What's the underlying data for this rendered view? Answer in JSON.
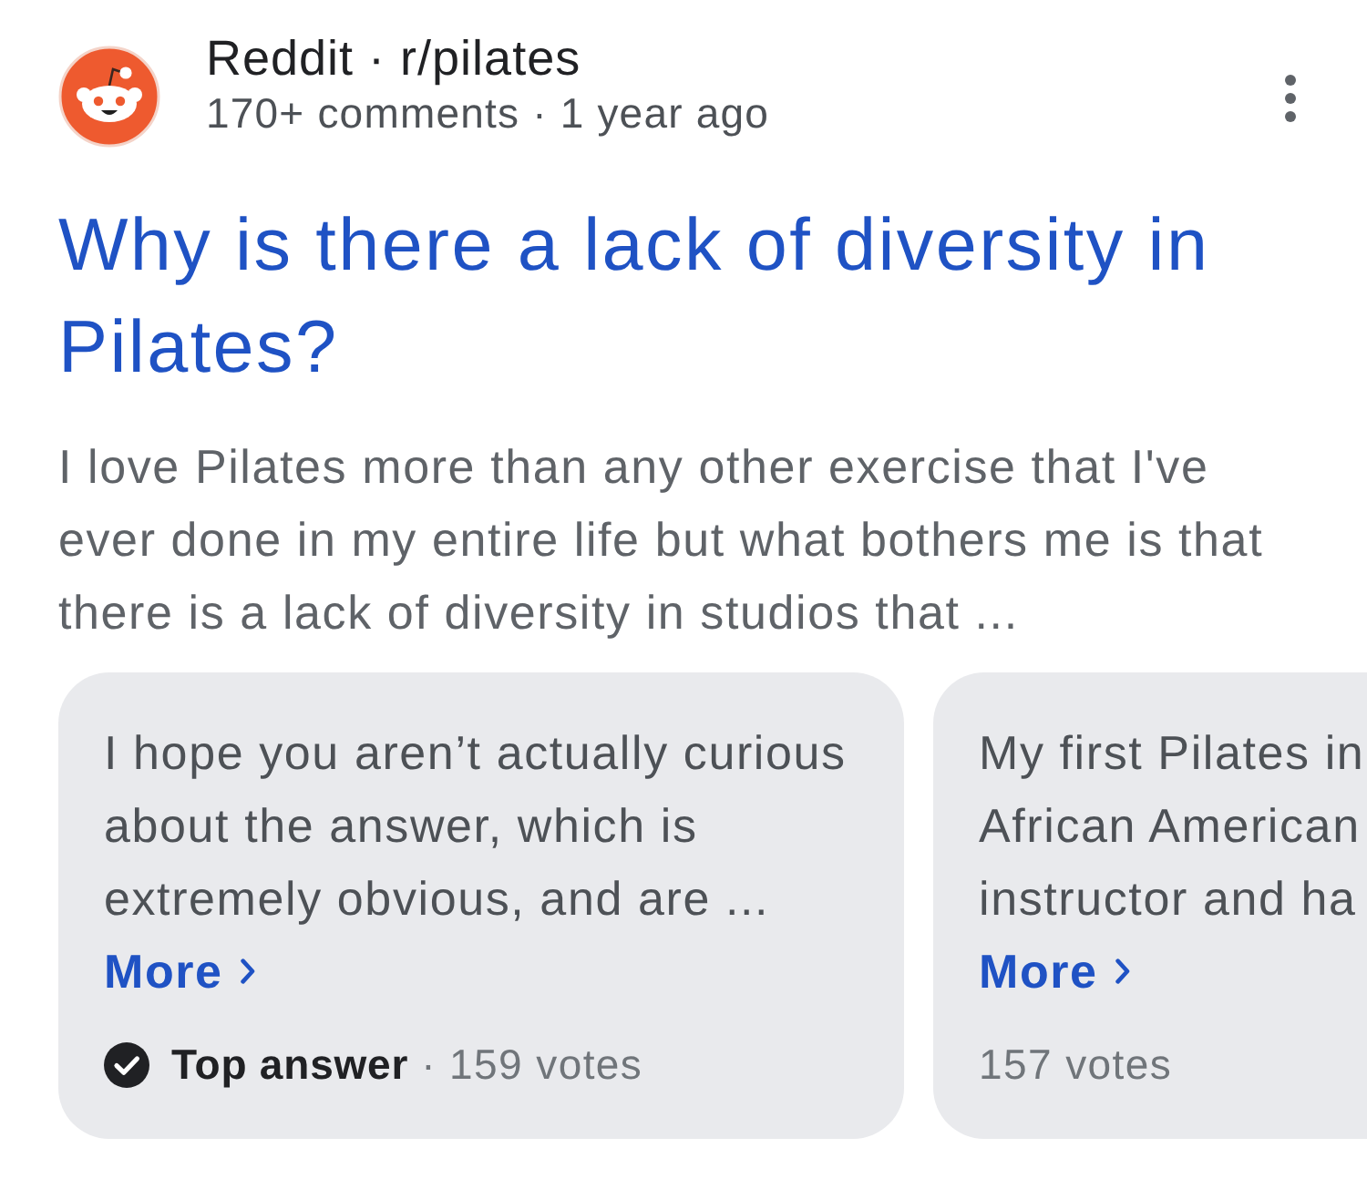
{
  "source": {
    "name": "Reddit · r/pilates",
    "meta": "170+ comments · 1 year ago"
  },
  "title": "Why is there a lack of diversity in Pilates?",
  "snippet": "I love Pilates more than any other exercise that I've ever done in my entire life but what bothers me is that there is a lack of diversity in studios that ...",
  "answers": [
    {
      "text": "I hope you aren’t actually curious about the answer, which is extremely obvious, and are ...",
      "more": "More",
      "badge": "Top answer",
      "votes": "· 159 votes"
    },
    {
      "text": "My first Pilates in\nAfrican American\ninstructor and ha",
      "more": "More",
      "votes": "157 votes"
    }
  ]
}
